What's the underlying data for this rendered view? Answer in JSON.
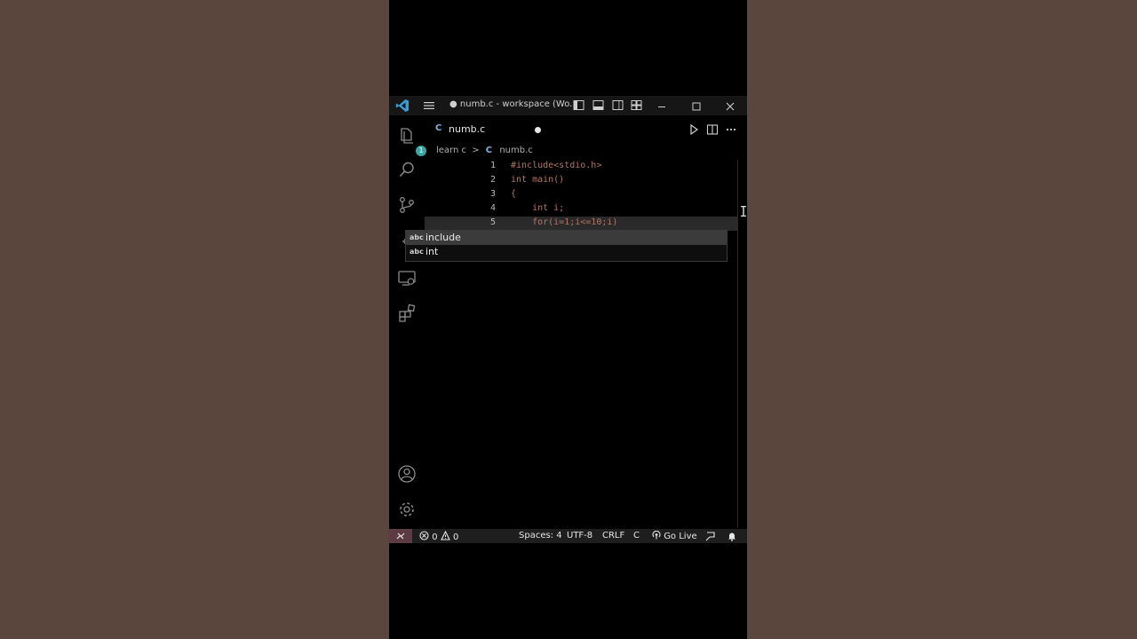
{
  "window": {
    "title": "● numb.c - workspace (Wo...",
    "controls": [
      "minimize-icon",
      "maximize-icon",
      "close-icon"
    ]
  },
  "activity_bar": {
    "explorer_badge": "1",
    "icons": [
      "explorer-icon",
      "search-icon",
      "source-control-icon",
      "remote-explorer-icon",
      "extensions-icon",
      "account-icon",
      "manage-gear-icon"
    ]
  },
  "tab": {
    "lang_letter": "C",
    "label": "numb.c",
    "modified": true
  },
  "breadcrumb": {
    "folder": "learn c",
    "chevron": ">",
    "lang_letter": "C",
    "file": "numb.c"
  },
  "editor": {
    "lines": [
      {
        "number": "1",
        "text": "#include<stdio.h>"
      },
      {
        "number": "2",
        "text": "int main()"
      },
      {
        "number": "3",
        "text": "{"
      },
      {
        "number": "4",
        "text": "    int i;"
      },
      {
        "number": "5",
        "text": "    for(i=1;i<=10;i)"
      }
    ]
  },
  "suggest": {
    "items": [
      {
        "kind": "abc",
        "label": "include"
      },
      {
        "kind": "abc",
        "label": "int"
      }
    ]
  },
  "status_bar": {
    "errors": "0",
    "warnings": "0",
    "spaces": "Spaces: 4",
    "encoding": "UTF-8",
    "eol": "CRLF",
    "language": "C",
    "go_live": "Go Live"
  },
  "colors": {
    "accent": "#3aa6a6",
    "code": "#b0786a",
    "remote": "#5c3b42",
    "background": "#5b463d"
  }
}
